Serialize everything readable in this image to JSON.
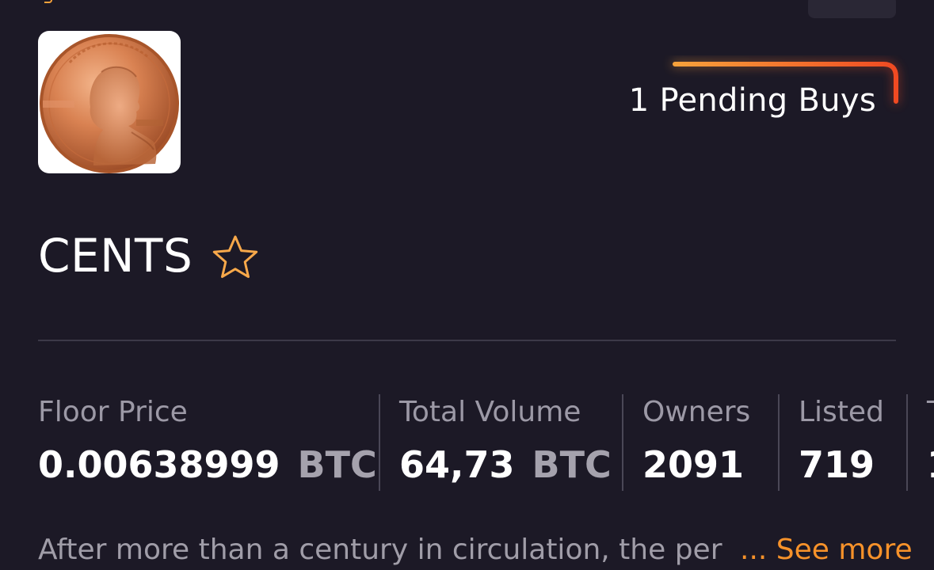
{
  "collection": {
    "name": "CENTS",
    "description": "After more than a century in circulation, the per",
    "see_more_label": "... See more"
  },
  "pending_buys": {
    "label": "1 Pending Buys"
  },
  "stats": {
    "floor_price": {
      "label": "Floor Price",
      "value": "0.00638999",
      "unit": "BTC"
    },
    "total_volume": {
      "label": "Total Volume",
      "value": "64,73",
      "unit": "BTC"
    },
    "owners": {
      "label": "Owners",
      "value": "2091"
    },
    "listed": {
      "label": "Listed",
      "value": "719"
    },
    "next_partial": {
      "label": "T",
      "value": "1"
    }
  },
  "icons": {
    "favorite": "star-outline-icon",
    "avatar": "penny-coin-image"
  },
  "colors": {
    "background": "#1c1926",
    "accent": "#f7922a",
    "accent_red": "#f04a22",
    "muted_text": "#9c99a6",
    "divider": "#3c3948"
  }
}
